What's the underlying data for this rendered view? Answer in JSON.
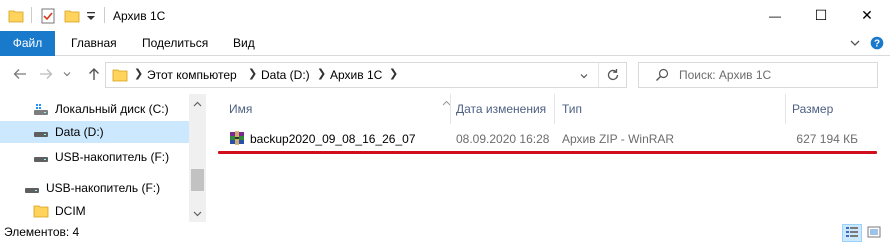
{
  "window": {
    "title": "Архив 1С",
    "minimize_glyph": "—",
    "maximize_glyph": "☐",
    "close_glyph": "✕"
  },
  "ribbon": {
    "tabs": [
      "Файл",
      "Главная",
      "Поделиться",
      "Вид"
    ],
    "accent_color": "#1979ca"
  },
  "address": {
    "crumbs": [
      "Этот компьютер",
      "Data (D:)",
      "Архив 1С"
    ]
  },
  "search": {
    "placeholder": "Поиск: Архив 1С"
  },
  "nav": {
    "items": [
      {
        "label": "Локальный диск (C:)",
        "icon": "drive-icon",
        "selected": false
      },
      {
        "label": "Data (D:)",
        "icon": "drive-icon",
        "selected": true
      },
      {
        "label": "USB-накопитель (F:)",
        "icon": "usb-drive-icon",
        "selected": false
      },
      {
        "label": "USB-накопитель (F:)",
        "icon": "usb-drive-icon",
        "selected": false
      },
      {
        "label": "DCIM",
        "icon": "folder-icon",
        "selected": false
      }
    ]
  },
  "columns": [
    "Имя",
    "Дата изменения",
    "Тип",
    "Размер"
  ],
  "files": [
    {
      "name": "backup2020_09_08_16_26_07",
      "date": "08.09.2020 16:28",
      "type": "Архив ZIP - WinRAR",
      "size": "627 194 КБ",
      "icon": "winrar-archive-icon"
    }
  ],
  "highlight_color": "#d10f1c",
  "status": {
    "text": "Элементов: 4"
  }
}
